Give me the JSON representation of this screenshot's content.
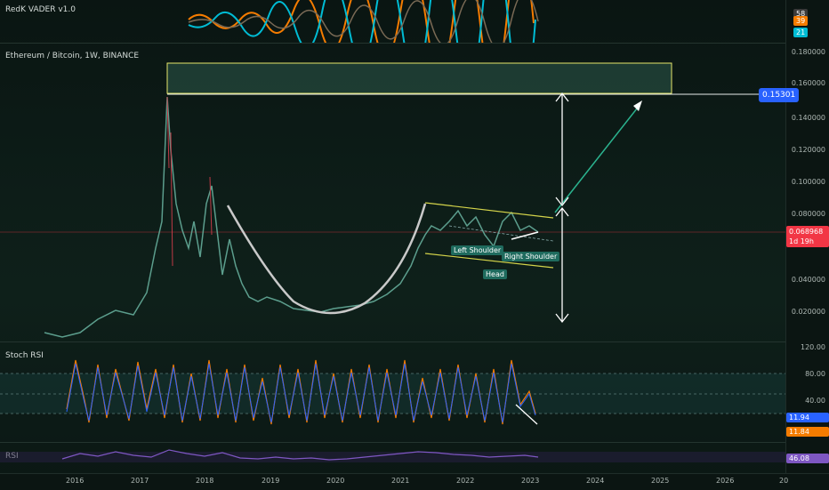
{
  "vader": {
    "title": "RedK VADER v1.0",
    "badge_top": "58",
    "badge_orange": "39",
    "badge_cyan": "21"
  },
  "main": {
    "title": "Ethereum / Bitcoin, 1W, BINANCE",
    "target_price": "0.15301",
    "current_price": "0.068968",
    "countdown": "1d 19h",
    "price_ticks": [
      "0.180000",
      "0.160000",
      "0.140000",
      "0.120000",
      "0.100000",
      "0.080000",
      "0.040000",
      "0.020000"
    ],
    "annotations": {
      "left_shoulder": "Left Shoulder",
      "head": "Head",
      "right_shoulder": "Right Shoulder"
    }
  },
  "stoch": {
    "title": "Stoch RSI",
    "ticks": [
      "120.00",
      "80.00",
      "40.00"
    ],
    "value_blue": "11.94",
    "value_orange": "11.84"
  },
  "rsi": {
    "title": "RSI",
    "value": "46.08"
  },
  "time_axis": [
    "2016",
    "2017",
    "2018",
    "2019",
    "2020",
    "2021",
    "2022",
    "2023",
    "2024",
    "2025",
    "2026",
    "20"
  ],
  "colors": {
    "target_blue": "#2962ff",
    "price_red": "#f23645",
    "orange": "#f57c00",
    "cyan": "#00bcd4",
    "rsi_purple": "#7e57c2",
    "label_teal": "#1f6b5e"
  }
}
